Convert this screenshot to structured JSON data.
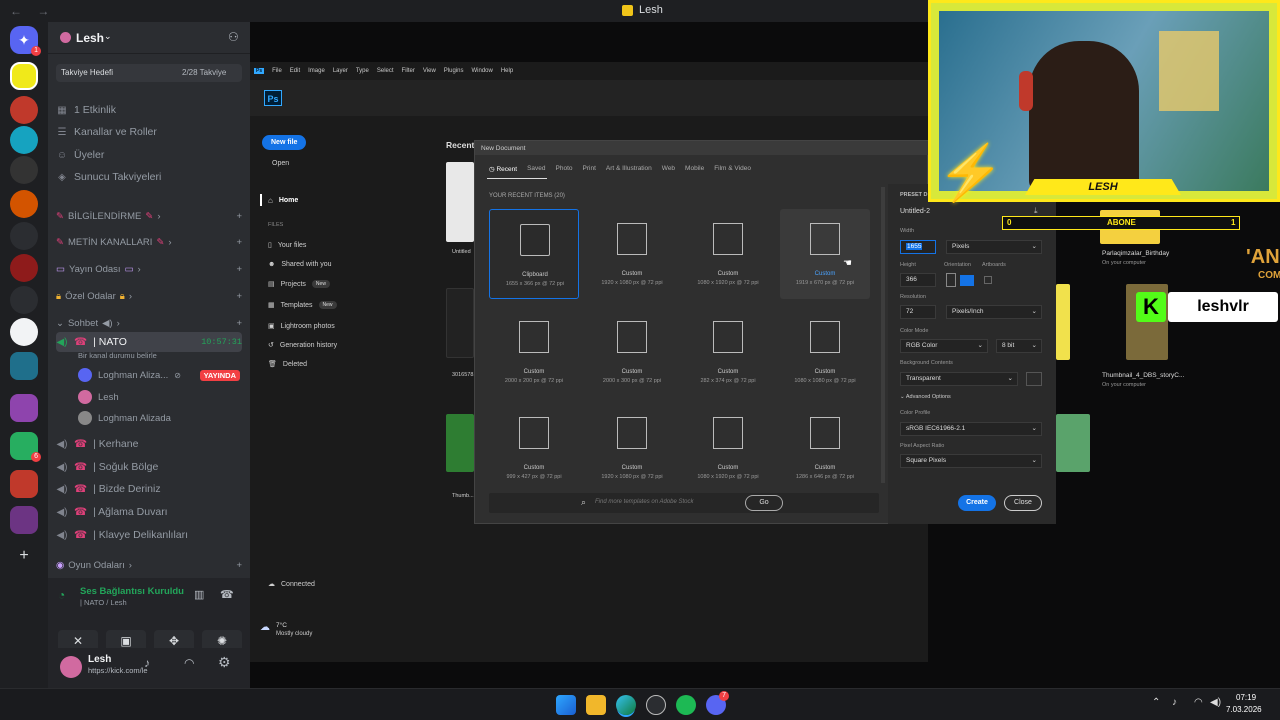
{
  "window": {
    "title": "Lesh",
    "nav": "← →"
  },
  "server_rail": {
    "badges": [
      "1",
      "6",
      "7"
    ]
  },
  "server": {
    "name": "Lesh",
    "boost": {
      "label": "Takviye Hedefi",
      "progress": "2/28 Takviye"
    },
    "items": [
      "1 Etkinlik",
      "Kanallar ve Roller",
      "Üyeler",
      "Sunucu Takviyeleri"
    ],
    "categories": [
      "BİLGİLENDİRME",
      "METİN KANALLARI",
      "Yayın Odası",
      "Özel Odalar",
      "Sohbet",
      "Oyun Odaları"
    ],
    "voice_channel": {
      "name": "| NATO",
      "timer": "10:57:31",
      "status": "Bir kanal durumu belirle"
    },
    "voice_members": [
      {
        "name": "Loghman Aliza...",
        "badge": "YAYINDA"
      },
      {
        "name": "Lesh"
      },
      {
        "name": "Loghman Alizada"
      }
    ],
    "channels": [
      "| Kerhane",
      "| Soğuk Bölge",
      "| Bizde Deriniz",
      "| Ağlama Duvarı",
      "| Klavye Delikanlıları"
    ]
  },
  "voice_panel": {
    "status": "Ses Bağlantısı Kuruldu",
    "location": "| NATO / Lesh"
  },
  "user": {
    "name": "Lesh",
    "status": "https://kick.com/le"
  },
  "photoshop": {
    "menu": [
      "Ps",
      "File",
      "Edit",
      "Image",
      "Layer",
      "Type",
      "Select",
      "Filter",
      "View",
      "Plugins",
      "Window",
      "Help"
    ],
    "new_file": "New file",
    "open": "Open",
    "home": "Home",
    "files_header": "FILES",
    "nav": [
      {
        "label": "Your files"
      },
      {
        "label": "Shared with you"
      },
      {
        "label": "Projects",
        "tag": "New"
      },
      {
        "label": "Templates",
        "tag": "New"
      },
      {
        "label": "Lightroom photos"
      },
      {
        "label": "Generation history"
      },
      {
        "label": "Deleted"
      }
    ],
    "connected": "Connected",
    "recent_label": "Recent",
    "weather": {
      "temp": "7°C",
      "desc": "Mostly cloudy"
    },
    "right_files": [
      "Parlaqimzalar_Birthday",
      "On your computer",
      "Thumbnail_4_DBS_storyC...",
      "On your computer"
    ],
    "left_files": [
      "Untitled",
      "3016578...",
      "Thumb..."
    ],
    "dialog": {
      "title": "New Document",
      "tabs": [
        "Recent",
        "Saved",
        "Photo",
        "Print",
        "Art & Illustration",
        "Web",
        "Mobile",
        "Film & Video"
      ],
      "section": "YOUR RECENT ITEMS (20)",
      "items": [
        {
          "name": "Clipboard",
          "size": "1655 x 366 px @ 72 ppi"
        },
        {
          "name": "Custom",
          "size": "1920 x 1080 px @ 72 ppi"
        },
        {
          "name": "Custom",
          "size": "1080 x 1920 px @ 72 ppi"
        },
        {
          "name": "Custom",
          "size": "1919 x 670 px @ 72 ppi"
        },
        {
          "name": "Custom",
          "size": "2000 x 200 px @ 72 ppi"
        },
        {
          "name": "Custom",
          "size": "2000 x 300 px @ 72 ppi"
        },
        {
          "name": "Custom",
          "size": "282 x 374 px @ 72 ppi"
        },
        {
          "name": "Custom",
          "size": "1080 x 1080 px @ 72 ppi"
        },
        {
          "name": "Custom",
          "size": "999 x 427 px @ 72 ppi"
        },
        {
          "name": "Custom",
          "size": "1920 x 1080 px @ 72 ppi"
        },
        {
          "name": "Custom",
          "size": "1080 x 1920 px @ 72 ppi"
        },
        {
          "name": "Custom",
          "size": "1286 x 646 px @ 72 ppi"
        }
      ],
      "search_placeholder": "Find more templates on Adobe Stock",
      "go": "Go",
      "preset": {
        "header": "PRESET D",
        "name": "Untitled-2",
        "width_label": "Width",
        "width": "1655",
        "unit": "Pixels",
        "height_label": "Height",
        "height": "366",
        "orientation_label": "Orientation",
        "artboards_label": "Artboards",
        "resolution_label": "Resolution",
        "resolution": "72",
        "resolution_unit": "Pixels/Inch",
        "color_mode_label": "Color Mode",
        "color_mode": "RGB Color",
        "bit": "8 bit",
        "bg_label": "Background Contents",
        "bg": "Transparent",
        "advanced": "Advanced Options",
        "profile_label": "Color Profile",
        "profile": "sRGB IEC61966-2.1",
        "aspect_label": "Pixel Aspect Ratio",
        "aspect": "Square Pixels"
      },
      "create": "Create",
      "close": "Close"
    }
  },
  "overlay": {
    "cam_name": "LESH",
    "abone_label": "ABONE",
    "abone_left": "0",
    "abone_right": "1",
    "kick_user": "leshvlr",
    "ad_text": "'AN",
    "ad_sub": "COM"
  },
  "taskbar": {
    "time": "07:19",
    "date": "7.03.2026"
  }
}
